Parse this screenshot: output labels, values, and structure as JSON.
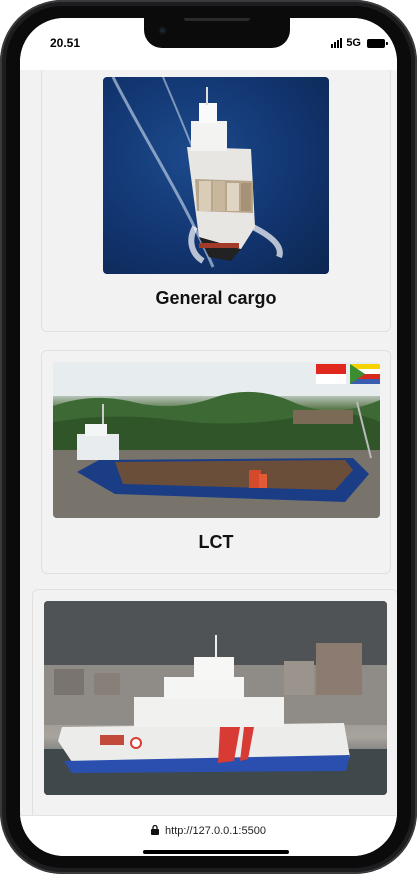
{
  "status_bar": {
    "time": "20.51",
    "network": "5G"
  },
  "cards": [
    {
      "title": "General cargo"
    },
    {
      "title": "LCT"
    },
    {
      "title": ""
    }
  ],
  "browser": {
    "url": "http://127.0.0.1:5500"
  },
  "colors": {
    "screen_bg": "#f2f2f2",
    "card_border": "#e0e0e0",
    "text": "#111111"
  },
  "icons": [
    "signal-icon",
    "battery-icon",
    "lock-icon"
  ]
}
